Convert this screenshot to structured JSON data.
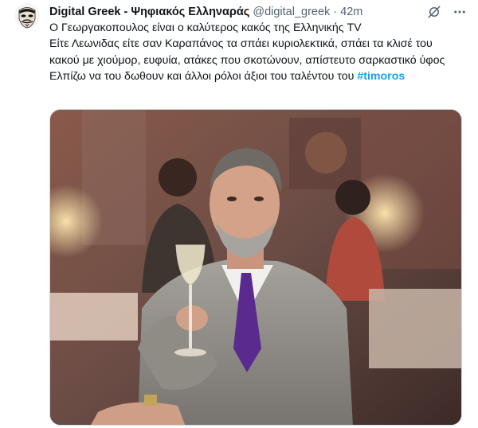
{
  "tweet": {
    "author_name": "Digital Greek - Ψηφιακός Ελληναράς",
    "author_handle": "@digital_greek",
    "separator": "·",
    "time": "42m",
    "text_lines": [
      "Ο Γεωργακοπουλος είναι ο καλύτερος κακός της Ελληνικής TV",
      "Είτε Λεωνιδας είτε σαν Καραπάνος τα σπάει κυριολεκτικά, σπάει τα κλισέ του κακού με χιούμορ, ευφυία, ατάκες που σκοτώνουν, απίστευτο σαρκαστικό ύφος",
      "Ελπίζω να του δωθουν και άλλοι ρόλοι άξιοι του ταλέντου του"
    ],
    "hashtag": "#timoros"
  },
  "icons": {
    "avatar": "mask-avatar-icon",
    "actions": [
      "grok-icon",
      "more-icon"
    ]
  },
  "colors": {
    "link": "#1d9bf0",
    "secondary_text": "#536471",
    "primary_text": "#0f1419"
  }
}
